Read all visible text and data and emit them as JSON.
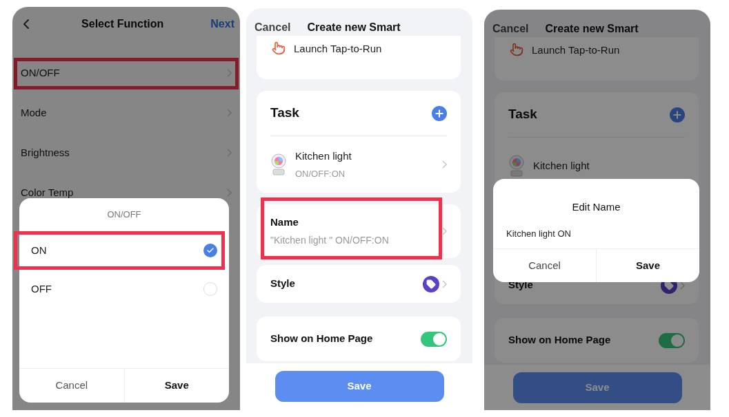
{
  "screens": [
    {
      "kind": "function_select",
      "dimmed": true,
      "title": "Select Function",
      "action": "Next",
      "functions": [
        {
          "label": "ON/OFF",
          "highlighted": true
        },
        {
          "label": "Mode",
          "highlighted": false
        },
        {
          "label": "Brightness",
          "highlighted": false
        },
        {
          "label": "Color Temp",
          "highlighted": false
        }
      ],
      "sheet": {
        "title": "ON/OFF",
        "options": [
          {
            "label": "ON",
            "selected": true,
            "highlighted": true
          },
          {
            "label": "OFF",
            "selected": false,
            "highlighted": false
          }
        ],
        "buttons": [
          "Cancel",
          "Save"
        ]
      }
    },
    {
      "kind": "smart_form",
      "dimmed": false,
      "cancel": "Cancel",
      "title": "Create new Smart",
      "launch": "Launch Tap-to-Run",
      "task": {
        "title": "Task",
        "device": "Kitchen light",
        "state": "ON/OFF:ON"
      },
      "name": {
        "label": "Name",
        "value": "\"Kitchen light \" ON/OFF:ON",
        "highlighted": true
      },
      "style": "Style",
      "home": {
        "label": "Show on Home Page",
        "on": true
      },
      "save": "Save"
    },
    {
      "kind": "smart_form",
      "dimmed": true,
      "cancel": "Cancel",
      "title": "Create new Smart",
      "launch": "Launch Tap-to-Run",
      "task": {
        "title": "Task",
        "device": "Kitchen light"
      },
      "style": "Style",
      "home": {
        "label": "Show on Home Page",
        "on": true
      },
      "save": "Save",
      "dialog": {
        "title": "Edit Name",
        "value": "Kitchen light ON",
        "buttons": [
          "Cancel",
          "Save"
        ]
      }
    }
  ]
}
